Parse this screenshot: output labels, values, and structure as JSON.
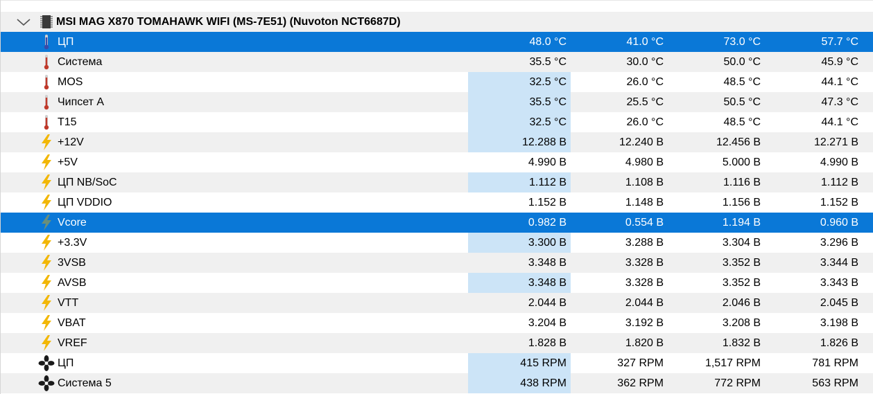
{
  "device": {
    "title": "MSI MAG X870 TOMAHAWK WIFI (MS-7E51) (Nuvoton NCT6687D)",
    "expanded": true
  },
  "colors": {
    "selection": "#0a78d7",
    "cell_highlight": "#cce4f7",
    "stripe": "#f0f0f0",
    "temp_icon_red": "#c0392b",
    "temp_icon_blue": "#3b4aa8",
    "volt_icon": "#f2b705",
    "volt_icon_selected": "#6a8f7a",
    "fan_icon": "#1a1a1a"
  },
  "sensors": [
    {
      "icon": "thermometer-icon",
      "name": "ЦП",
      "values": [
        "48.0 °C",
        "41.0 °C",
        "73.0 °C",
        "57.7 °C"
      ],
      "selected": true,
      "highlight_current": false
    },
    {
      "icon": "thermometer-icon",
      "name": "Система",
      "values": [
        "35.5 °C",
        "30.0 °C",
        "50.0 °C",
        "45.9 °C"
      ],
      "selected": false,
      "highlight_current": false
    },
    {
      "icon": "thermometer-icon",
      "name": "MOS",
      "values": [
        "32.5 °C",
        "26.0 °C",
        "48.5 °C",
        "44.1 °C"
      ],
      "selected": false,
      "highlight_current": true
    },
    {
      "icon": "thermometer-icon",
      "name": "Чипсет A",
      "values": [
        "35.5 °C",
        "25.5 °C",
        "50.5 °C",
        "47.3 °C"
      ],
      "selected": false,
      "highlight_current": true
    },
    {
      "icon": "thermometer-icon",
      "name": "T15",
      "values": [
        "32.5 °C",
        "26.0 °C",
        "48.5 °C",
        "44.1 °C"
      ],
      "selected": false,
      "highlight_current": true
    },
    {
      "icon": "lightning-icon",
      "name": "+12V",
      "values": [
        "12.288 В",
        "12.240 В",
        "12.456 В",
        "12.271 В"
      ],
      "selected": false,
      "highlight_current": true
    },
    {
      "icon": "lightning-icon",
      "name": "+5V",
      "values": [
        "4.990 В",
        "4.980 В",
        "5.000 В",
        "4.990 В"
      ],
      "selected": false,
      "highlight_current": false
    },
    {
      "icon": "lightning-icon",
      "name": "ЦП NB/SoC",
      "values": [
        "1.112 В",
        "1.108 В",
        "1.116 В",
        "1.112 В"
      ],
      "selected": false,
      "highlight_current": true
    },
    {
      "icon": "lightning-icon",
      "name": "ЦП VDDIO",
      "values": [
        "1.152 В",
        "1.148 В",
        "1.156 В",
        "1.152 В"
      ],
      "selected": false,
      "highlight_current": false
    },
    {
      "icon": "lightning-icon",
      "name": "Vcore",
      "values": [
        "0.982 В",
        "0.554 В",
        "1.194 В",
        "0.960 В"
      ],
      "selected": true,
      "highlight_current": false
    },
    {
      "icon": "lightning-icon",
      "name": "+3.3V",
      "values": [
        "3.300 В",
        "3.288 В",
        "3.304 В",
        "3.296 В"
      ],
      "selected": false,
      "highlight_current": true
    },
    {
      "icon": "lightning-icon",
      "name": "3VSB",
      "values": [
        "3.348 В",
        "3.328 В",
        "3.352 В",
        "3.344 В"
      ],
      "selected": false,
      "highlight_current": false
    },
    {
      "icon": "lightning-icon",
      "name": "AVSB",
      "values": [
        "3.348 В",
        "3.328 В",
        "3.352 В",
        "3.343 В"
      ],
      "selected": false,
      "highlight_current": true
    },
    {
      "icon": "lightning-icon",
      "name": "VTT",
      "values": [
        "2.044 В",
        "2.044 В",
        "2.046 В",
        "2.045 В"
      ],
      "selected": false,
      "highlight_current": false
    },
    {
      "icon": "lightning-icon",
      "name": "VBAT",
      "values": [
        "3.204 В",
        "3.192 В",
        "3.208 В",
        "3.198 В"
      ],
      "selected": false,
      "highlight_current": false
    },
    {
      "icon": "lightning-icon",
      "name": "VREF",
      "values": [
        "1.828 В",
        "1.820 В",
        "1.832 В",
        "1.826 В"
      ],
      "selected": false,
      "highlight_current": false
    },
    {
      "icon": "fan-icon",
      "name": "ЦП",
      "values": [
        "415 RPM",
        "327 RPM",
        "1,517 RPM",
        "781 RPM"
      ],
      "selected": false,
      "highlight_current": true
    },
    {
      "icon": "fan-icon",
      "name": "Система 5",
      "values": [
        "438 RPM",
        "362 RPM",
        "772 RPM",
        "563 RPM"
      ],
      "selected": false,
      "highlight_current": true
    }
  ]
}
